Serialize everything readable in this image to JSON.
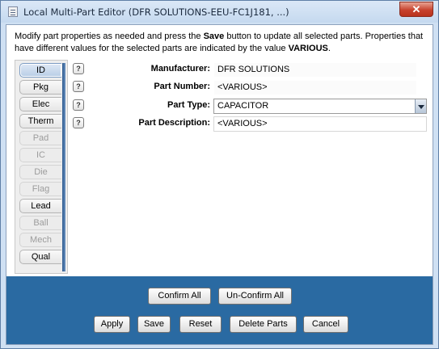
{
  "window": {
    "title": "Local Multi-Part Editor (DFR SOLUTIONS-EEU-FC1J181, ...)",
    "close_glyph": "✕"
  },
  "instructions": {
    "part1": "Modify part properties as needed and press the ",
    "save_word": "Save",
    "part2": " button to update all selected parts. Properties that have different values for the selected parts are indicated by the value ",
    "various_word": "VARIOUS",
    "part3": "."
  },
  "tabs": [
    {
      "label": "ID",
      "state": "active"
    },
    {
      "label": "Pkg",
      "state": "enabled"
    },
    {
      "label": "Elec",
      "state": "enabled"
    },
    {
      "label": "Therm",
      "state": "enabled"
    },
    {
      "label": "Pad",
      "state": "disabled"
    },
    {
      "label": "IC",
      "state": "disabled"
    },
    {
      "label": "Die",
      "state": "disabled"
    },
    {
      "label": "Flag",
      "state": "disabled"
    },
    {
      "label": "Lead",
      "state": "enabled"
    },
    {
      "label": "Ball",
      "state": "disabled"
    },
    {
      "label": "Mech",
      "state": "disabled"
    },
    {
      "label": "Qual",
      "state": "enabled"
    }
  ],
  "form": {
    "help_glyph": "?",
    "manufacturer": {
      "label": "Manufacturer:",
      "value": "DFR SOLUTIONS"
    },
    "part_number": {
      "label": "Part Number:",
      "value": "<VARIOUS>"
    },
    "part_type": {
      "label": "Part Type:",
      "value": "CAPACITOR"
    },
    "part_description": {
      "label": "Part Description:",
      "value": "<VARIOUS>"
    }
  },
  "buttons": {
    "confirm_all": "Confirm All",
    "unconfirm_all": "Un-Confirm All",
    "apply": "Apply",
    "save": "Save",
    "reset": "Reset",
    "delete_parts": "Delete Parts",
    "cancel": "Cancel"
  },
  "colors": {
    "accent": "#2a6aa2",
    "title_bg": "#c5d9ef",
    "close": "#c7432e"
  }
}
